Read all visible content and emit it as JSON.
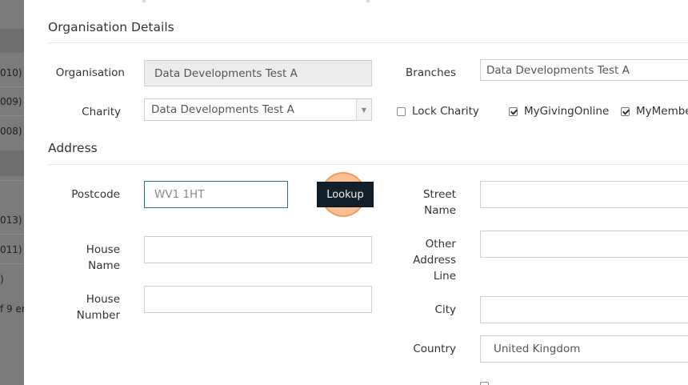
{
  "background_list": {
    "rows": [
      "010)",
      "009)",
      "008)",
      "013)",
      "011)",
      ")",
      "f 9 en"
    ]
  },
  "organisation_details": {
    "title": "Organisation Details",
    "organisation_label": "Organisation",
    "organisation_value": "Data Developments Test A",
    "branches_label": "Branches",
    "branches_value": "Data Developments Test A",
    "charity_label": "Charity",
    "charity_value": "Data Developments Test A",
    "lock_charity_label": "Lock Charity",
    "lock_charity_checked": false,
    "mygivingonline_label": "MyGivingOnline",
    "mygivingonline_checked": true,
    "mymember_label": "MyMembe",
    "mymember_checked": true
  },
  "address": {
    "title": "Address",
    "postcode_label": "Postcode",
    "postcode_value": "WV1 1HT",
    "lookup_label": "Lookup",
    "house_name_label_1": "House",
    "house_name_label_2": "Name",
    "house_name_value": "",
    "house_number_label_1": "House",
    "house_number_label_2": "Number",
    "house_number_value": "",
    "street_name_label_1": "Street",
    "street_name_label_2": "Name",
    "street_name_value": "",
    "other_address_label_1": "Other",
    "other_address_label_2": "Address",
    "other_address_label_3": "Line",
    "other_address_value": "",
    "city_label": "City",
    "city_value": "",
    "country_label": "Country",
    "country_value": "United Kingdom"
  },
  "colors": {
    "button_dark": "#11202a",
    "click_highlight": "#f28c3c",
    "focus_border": "#2a6f8f"
  }
}
